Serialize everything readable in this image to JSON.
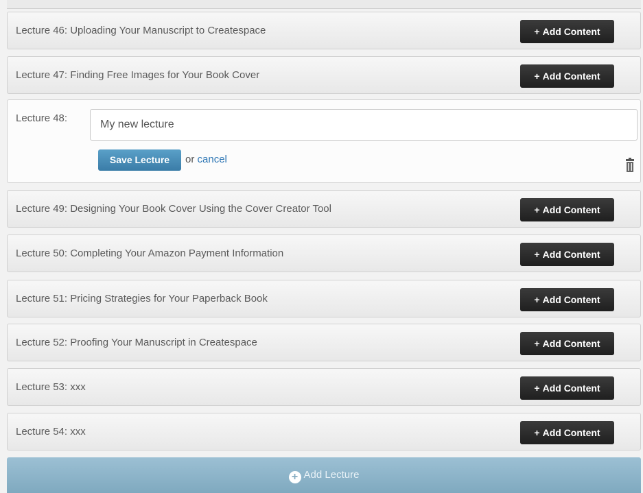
{
  "lectures_before": [
    {
      "title": "Lecture 46: Uploading Your Manuscript to Createspace",
      "button_label": "Add Content"
    },
    {
      "title": "Lecture 47: Finding Free Images for Your Book Cover",
      "button_label": "Add Content"
    }
  ],
  "editor": {
    "label": "Lecture 48:",
    "input_value": "My new lecture",
    "save_label": "Save Lecture",
    "or_label": "or",
    "cancel_label": "cancel"
  },
  "lectures_after": [
    {
      "title": "Lecture 49: Designing Your Book Cover Using the Cover Creator Tool",
      "button_label": "Add Content"
    },
    {
      "title": "Lecture 50: Completing Your Amazon Payment Information",
      "button_label": "Add Content"
    },
    {
      "title": "Lecture 51: Pricing Strategies for Your Paperback Book",
      "button_label": "Add Content"
    },
    {
      "title": "Lecture 52: Proofing Your Manuscript in Createspace",
      "button_label": "Add Content"
    },
    {
      "title": "Lecture 53: xxx",
      "button_label": "Add Content"
    },
    {
      "title": "Lecture 54: xxx",
      "button_label": "Add Content"
    }
  ],
  "footer": {
    "add_lecture_label": "Add Lecture"
  },
  "icons": {
    "plus": "+",
    "trash": "trash-icon"
  },
  "colors": {
    "dark_button": "#2a2a2a",
    "save_button": "#3a7ca7",
    "add_lecture_bar": "#8fb5c9",
    "link": "#2f77b5"
  }
}
